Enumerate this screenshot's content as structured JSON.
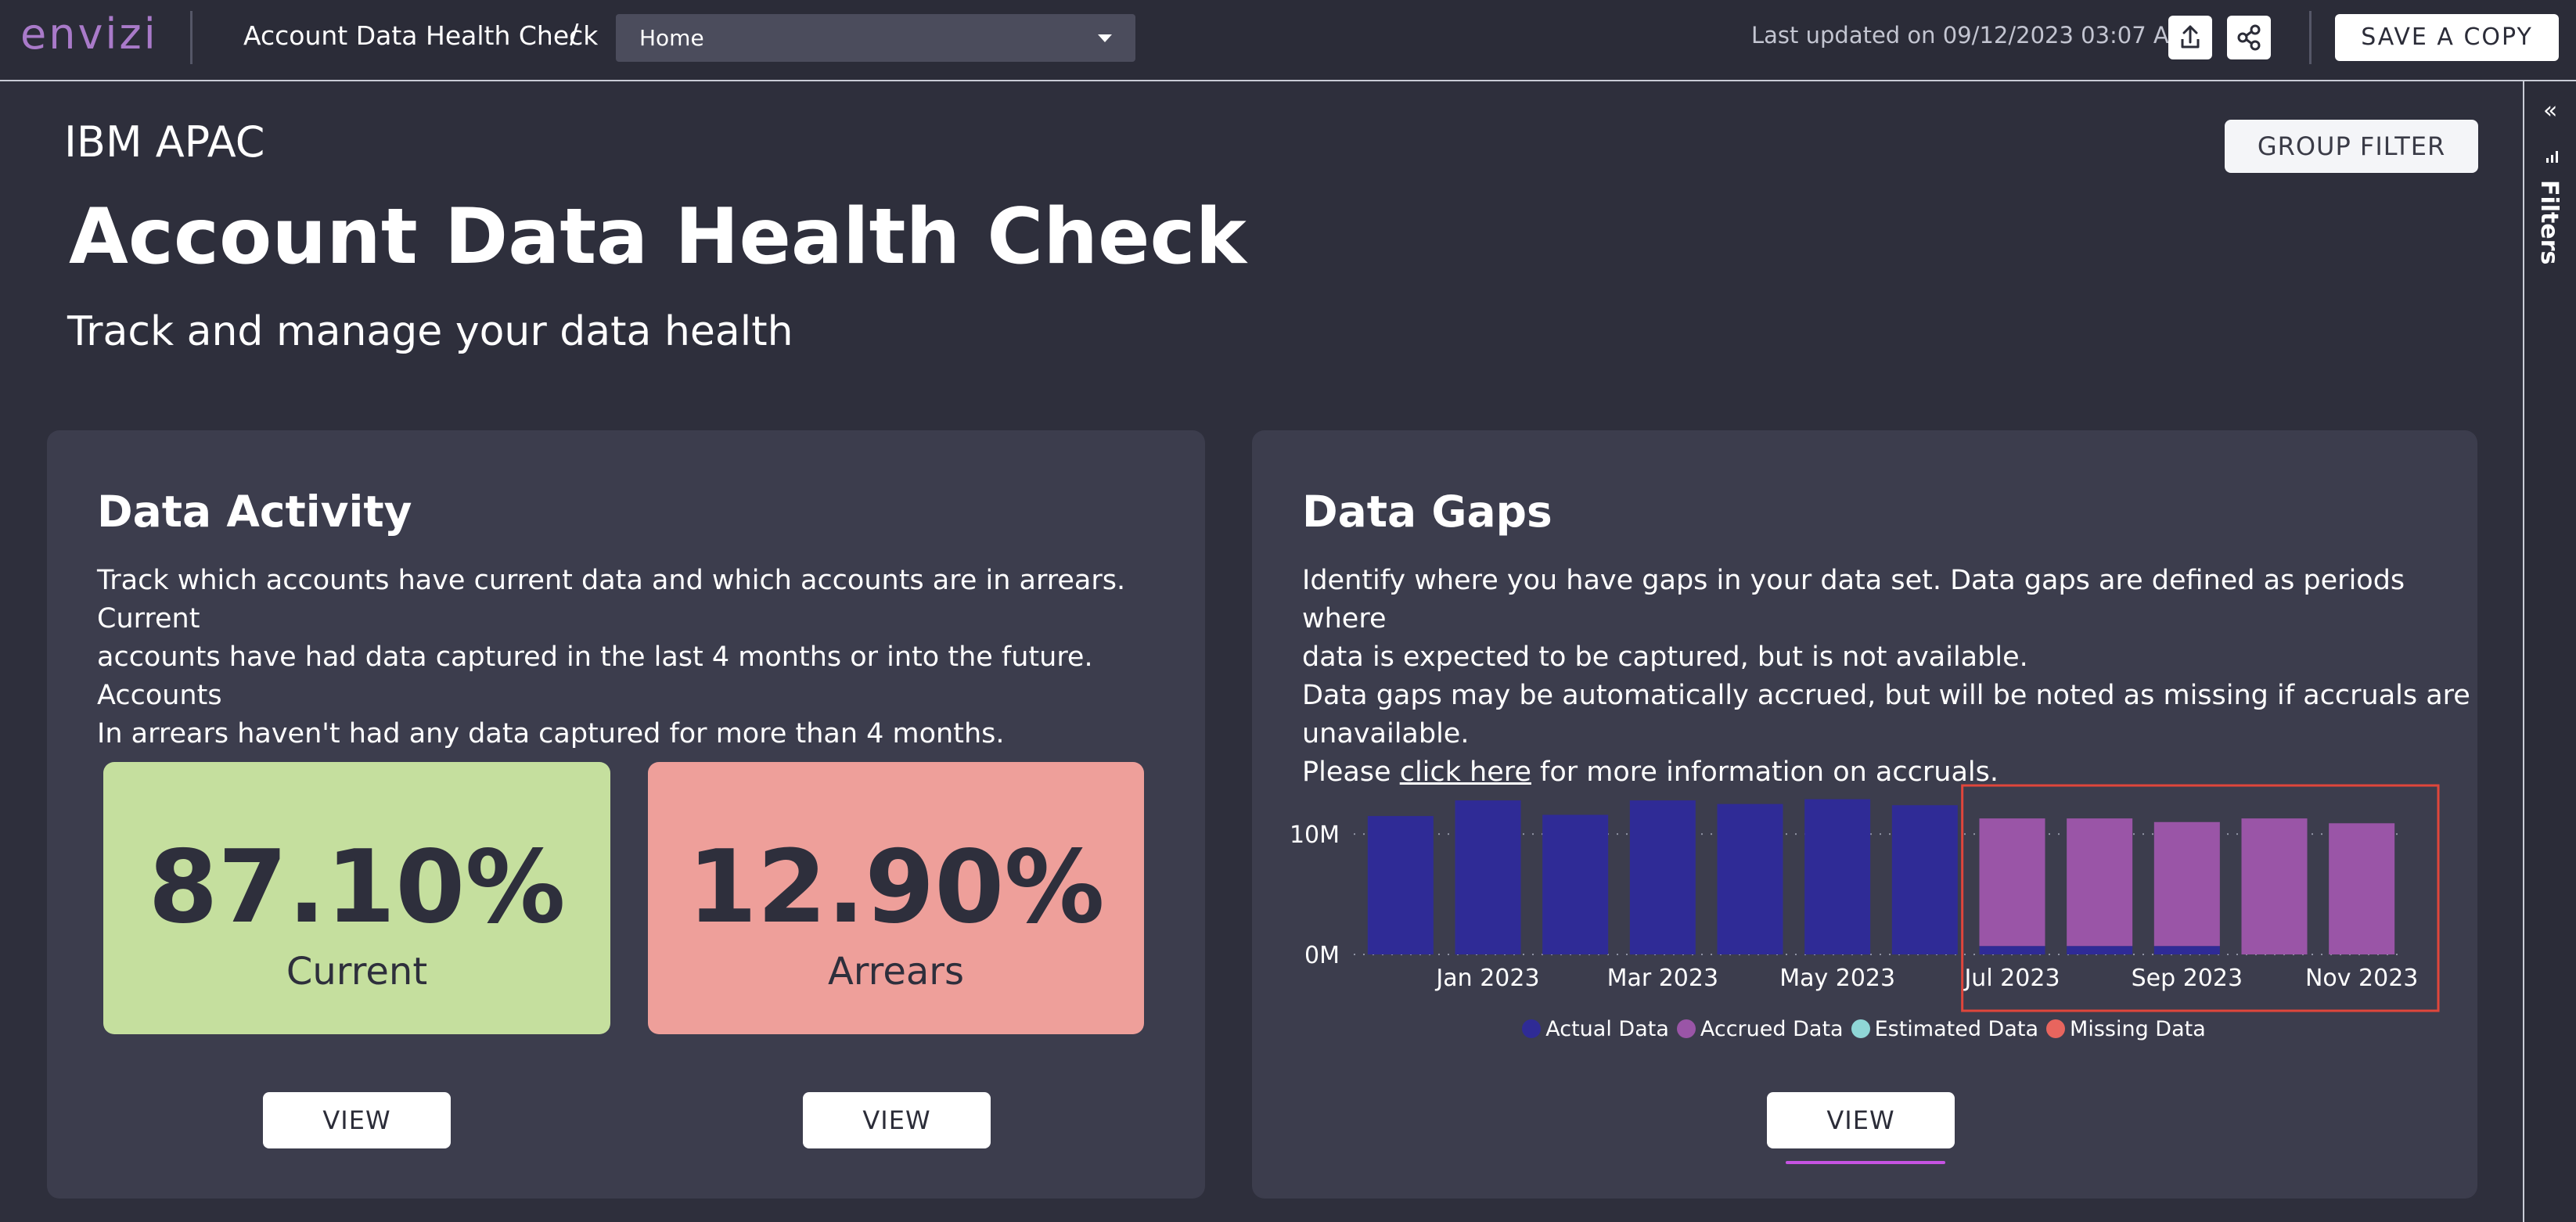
{
  "app": {
    "logo_text": "envizi",
    "breadcrumb": "Account Data Health Check",
    "breadcrumb_sep": "/",
    "page_select": "Home",
    "last_updated": "Last updated on 09/12/2023 03:07 AM",
    "share_icon": "upload-icon",
    "link_icon": "share-nodes-icon",
    "save_copy": "SAVE A COPY"
  },
  "rail": {
    "collapse_glyph": "«",
    "filters_label": "Filters"
  },
  "header": {
    "org": "IBM APAC",
    "title": "Account Data Health Check",
    "subtitle": "Track and manage your data health",
    "group_filter": "GROUP FILTER"
  },
  "activity": {
    "title": "Data Activity",
    "desc_lines": [
      "Track which accounts have current data and which accounts are in arrears.  Current",
      "accounts have had data captured in the last 4 months or into the future.  Accounts",
      "In arrears haven't had any data captured for more than 4 months."
    ],
    "current": {
      "value": "87.10%",
      "label": "Current",
      "color": "#c5df9e"
    },
    "arrears": {
      "value": "12.90%",
      "label": "Arrears",
      "color": "#ee9f9a"
    },
    "view_current": "VIEW",
    "view_arrears": "VIEW"
  },
  "gaps": {
    "title": "Data Gaps",
    "desc_lines": [
      "Identify where you have gaps in your data set. Data gaps are defined as periods where",
      "data is expected to be captured, but is not available.",
      "Data gaps may be automatically accrued, but will be noted as missing if accruals are",
      "unavailable."
    ],
    "link_prefix": "Please ",
    "link_text": "click here",
    "link_suffix": " for more information on accruals.",
    "view": "VIEW"
  },
  "chart_data": {
    "type": "bar",
    "stacked": true,
    "categories": [
      "Dec 2022",
      "Jan 2023",
      "Feb 2023",
      "Mar 2023",
      "Apr 2023",
      "May 2023",
      "Jun 2023",
      "Jul 2023",
      "Aug 2023",
      "Sep 2023",
      "Oct 2023",
      "Nov 2023"
    ],
    "tick_labels": [
      "Jan 2023",
      "Mar 2023",
      "May 2023",
      "Jul 2023",
      "Sep 2023",
      "Nov 2023"
    ],
    "y_tick_labels": [
      "0M",
      "10M"
    ],
    "ylim": [
      0,
      13
    ],
    "series": [
      {
        "name": "Actual Data",
        "color": "#2f2b96",
        "values": [
          11.5,
          12.8,
          11.6,
          12.8,
          12.5,
          12.9,
          12.4,
          0.7,
          0.7,
          0.7,
          0,
          0
        ]
      },
      {
        "name": "Accrued Data",
        "color": "#9a55a7",
        "values": [
          0,
          0,
          0,
          0,
          0,
          0,
          0,
          10.6,
          10.6,
          10.3,
          11.3,
          10.9
        ]
      },
      {
        "name": "Estimated Data",
        "color": "#8fd6d6",
        "values": [
          0,
          0,
          0,
          0,
          0,
          0,
          0,
          0,
          0,
          0,
          0,
          0
        ]
      },
      {
        "name": "Missing Data",
        "color": "#e8655e",
        "values": [
          0,
          0,
          0,
          0,
          0,
          0,
          0,
          0,
          0,
          0,
          0,
          0
        ]
      }
    ],
    "highlight_range": [
      "Jul 2023",
      "Nov 2023"
    ],
    "highlight_color": "#e0463b",
    "legend_position": "bottom",
    "grid": "dotted"
  }
}
